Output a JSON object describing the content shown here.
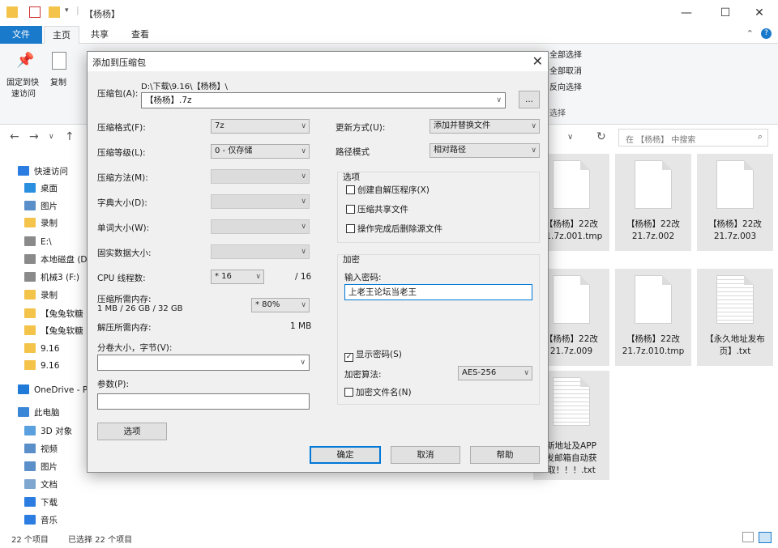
{
  "explorer": {
    "window_title": "【杨杨】",
    "ribbon_tabs": [
      "文件",
      "主页",
      "共享",
      "查看"
    ],
    "ribbon": {
      "pin_label_1": "固定到快",
      "pin_label_2": "速访问",
      "copy_label": "复制",
      "select_all": "全部选择",
      "select_none": "全部取消",
      "invert": "反向选择",
      "select_group": "选择"
    },
    "search_placeholder": "在 【杨杨】 中搜索",
    "nav": [
      {
        "label": "快速访问",
        "color": "#2b7de1"
      },
      {
        "label": "桌面",
        "color": "#2b8fe0"
      },
      {
        "label": "图片",
        "color": "#5b8fc9"
      },
      {
        "label": "录制",
        "color": "#f3c34a"
      },
      {
        "label": "E:\\",
        "color": "#8a8a8a"
      },
      {
        "label": "本地磁盘 (D",
        "color": "#8a8a8a"
      },
      {
        "label": "机械3 (F:)",
        "color": "#8a8a8a"
      },
      {
        "label": "录制",
        "color": "#f3c34a"
      },
      {
        "label": "【兔兔软糖",
        "color": "#f3c34a"
      },
      {
        "label": "【兔兔软糖",
        "color": "#f3c34a"
      },
      {
        "label": "9.16",
        "color": "#f3c34a"
      },
      {
        "label": "9.16",
        "color": "#f3c34a"
      },
      {
        "label": "OneDrive - P",
        "color": "#1f7ad8"
      },
      {
        "label": "此电脑",
        "color": "#3a86d6"
      },
      {
        "label": "3D 对象",
        "color": "#5aa0de"
      },
      {
        "label": "视频",
        "color": "#5b8fc9"
      },
      {
        "label": "图片",
        "color": "#5b8fc9"
      },
      {
        "label": "文档",
        "color": "#7fa6cf"
      },
      {
        "label": "下载",
        "color": "#2b7de1"
      },
      {
        "label": "音乐",
        "color": "#2b7de1"
      }
    ],
    "files": [
      {
        "line1": "【杨杨】22改",
        "line2": "21.7z.001.tmp"
      },
      {
        "line1": "【杨杨】22改",
        "line2": "21.7z.002"
      },
      {
        "line1": "【杨杨】22改",
        "line2": "21.7z.003"
      },
      {
        "line1": "【杨杨】22改",
        "line2": "21.7z.009"
      },
      {
        "line1": "【杨杨】22改",
        "line2": "21.7z.010.tmp"
      },
      {
        "line1": "【永久地址发布",
        "line2": "页】.txt"
      },
      {
        "line1": "新地址及APP",
        "line2": "发邮箱自动获",
        "line3": "取！！！.txt"
      }
    ],
    "status": {
      "count": "22 个项目",
      "selected": "已选择 22 个项目"
    }
  },
  "dialog": {
    "title": "添加到压缩包",
    "archive_label": "压缩包(A):",
    "archive_path": "D:\\下载\\9.16\\【杨杨】\\",
    "archive_name": "【杨杨】.7z",
    "browse": "...",
    "format_label": "压缩格式(F):",
    "format_value": "7z",
    "level_label": "压缩等级(L):",
    "level_value": "0 - 仅存储",
    "method_label": "压缩方法(M):",
    "dict_label": "字典大小(D):",
    "word_label": "单词大小(W):",
    "solid_label": "固实数据大小:",
    "cpu_label": "CPU 线程数:",
    "cpu_value": "* 16",
    "cpu_max": "/ 16",
    "mem_label": "压缩所需内存:",
    "mem_detail": "1 MB / 26 GB / 32 GB",
    "mem_percent": "* 80%",
    "decomp_label": "解压所需内存:",
    "decomp_value": "1 MB",
    "split_label": "分卷大小，字节(V):",
    "params_label": "参数(P):",
    "options_btn": "选项",
    "update_label": "更新方式(U):",
    "update_value": "添加并替换文件",
    "path_label": "路径模式",
    "path_value": "相对路径",
    "options_group": "选项",
    "opt_sfx": "创建自解压程序(X)",
    "opt_shared": "压缩共享文件",
    "opt_delete": "操作完成后删除源文件",
    "enc_group": "加密",
    "pwd_label": "输入密码:",
    "pwd_value": "上老王论坛当老王",
    "show_pwd": "显示密码(S)",
    "show_pwd_checked": "✓",
    "enc_method_label": "加密算法:",
    "enc_method_value": "AES-256",
    "enc_names": "加密文件名(N)",
    "ok": "确定",
    "cancel": "取消",
    "help": "帮助"
  }
}
